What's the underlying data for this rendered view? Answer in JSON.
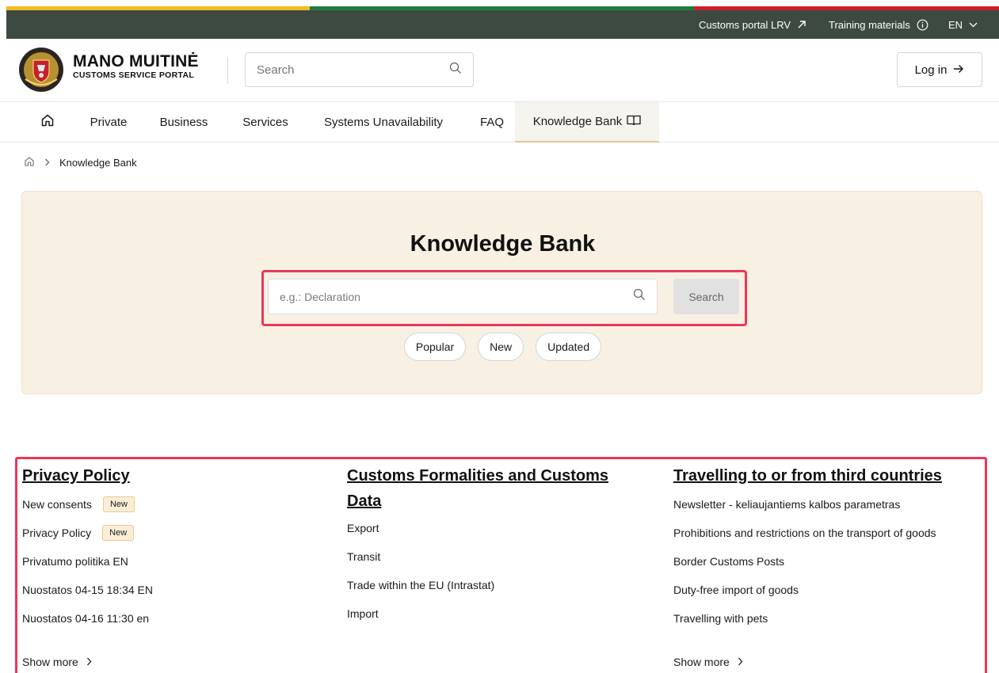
{
  "colors": {
    "topbar": "#3d4a40",
    "flag_yellow": "#f4b921",
    "flag_green": "#1e7d3c",
    "flag_red": "#c8202b",
    "hero_bg": "#f9f0e4",
    "highlight": "#e8385c"
  },
  "topbar": {
    "customs_portal": "Customs portal LRV",
    "training": "Training materials",
    "lang": "EN"
  },
  "header": {
    "logo_title": "MANO MUITINĖ",
    "logo_sub": "CUSTOMS SERVICE PORTAL",
    "search_placeholder": "Search",
    "login": "Log in"
  },
  "nav": {
    "private": "Private",
    "business": "Business",
    "services": "Services",
    "systems": "Systems Unavailability",
    "faq": "FAQ",
    "knowledge": "Knowledge Bank"
  },
  "breadcrumb": {
    "current": "Knowledge Bank"
  },
  "hero": {
    "title": "Knowledge Bank",
    "search_placeholder": "e.g.: Declaration",
    "search_button": "Search",
    "chips": [
      "Popular",
      "New",
      "Updated"
    ]
  },
  "categories": [
    {
      "title": "Privacy Policy",
      "items": [
        {
          "label": "New consents",
          "badge": "New"
        },
        {
          "label": "Privacy Policy",
          "badge": "New"
        },
        {
          "label": "Privatumo politika EN"
        },
        {
          "label": "Nuostatos 04-15 18:34 EN"
        },
        {
          "label": "Nuostatos 04-16 11:30 en"
        }
      ],
      "show_more": "Show more"
    },
    {
      "title_line1": "Customs Formalities and Customs",
      "title_line2": "Data",
      "items": [
        {
          "label": "Export"
        },
        {
          "label": "Transit"
        },
        {
          "label": "Trade within the EU (Intrastat)"
        },
        {
          "label": "Import"
        }
      ]
    },
    {
      "title": "Travelling to or from third countries",
      "items": [
        {
          "label": "Newsletter - keliaujantiems kalbos parametras"
        },
        {
          "label": "Prohibitions and restrictions on the transport of goods"
        },
        {
          "label": "Border Customs Posts"
        },
        {
          "label": "Duty-free import of goods"
        },
        {
          "label": "Travelling with pets"
        }
      ],
      "show_more": "Show more"
    }
  ]
}
